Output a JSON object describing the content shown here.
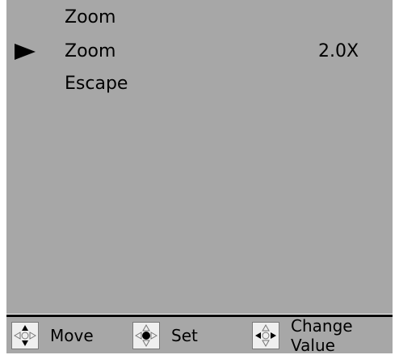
{
  "menu": {
    "title": "Zoom",
    "items": [
      {
        "label": "Zoom",
        "value": "2.0X",
        "selected": true
      },
      {
        "label": "Escape",
        "value": "",
        "selected": false
      }
    ]
  },
  "footer": {
    "move_label": "Move",
    "set_label": "Set",
    "change_value_label": "Change Value"
  },
  "colors": {
    "screen_bg": "#a7a7a7",
    "text": "#000000",
    "icon_bg": "#efefef"
  },
  "icons": {
    "cursor": "triangle-right-icon",
    "move": "dpad-up-down-icon",
    "set": "dpad-center-icon",
    "change_value": "dpad-left-right-icon"
  }
}
